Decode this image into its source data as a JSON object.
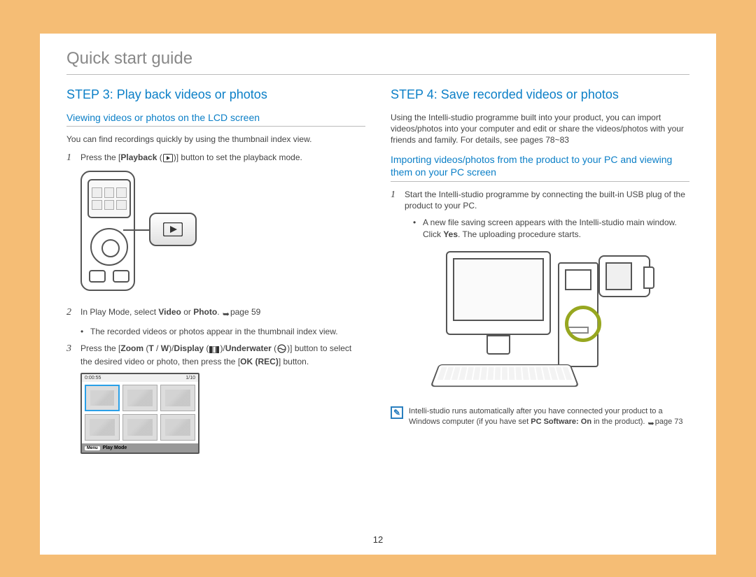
{
  "page_title": "Quick start guide",
  "page_number": "12",
  "left": {
    "step_heading": "STEP 3: Play back videos or photos",
    "sub_heading": "Viewing videos or photos on the LCD screen",
    "intro": "You can find recordings quickly by using the thumbnail index view.",
    "item1_num": "1",
    "item1_a": "Press the [",
    "item1_bold": "Playback",
    "item1_b": " (",
    "item1_c": ")] button to set the playback mode.",
    "item2_num": "2",
    "item2_a": "In Play Mode, select ",
    "item2_bold1": "Video",
    "item2_b": " or ",
    "item2_bold2": "Photo",
    "item2_c": ". ",
    "item2_ref": "page 59",
    "bullet2": "The recorded videos or photos appear in the thumbnail index view.",
    "item3_num": "3",
    "item3_a": "Press the [",
    "item3_bold1": "Zoom",
    "item3_b": " (",
    "item3_bold2": "T",
    "item3_c": " / ",
    "item3_bold3": "W",
    "item3_d": ")/",
    "item3_bold4": "Display",
    "item3_e": " (",
    "item3_f": ")/",
    "item3_bold5": "Underwater",
    "item3_g": " (",
    "item3_h": ")] button to select the desired video or photo, then press the [",
    "item3_bold6": "OK (REC)",
    "item3_i": "] button.",
    "thumb_time": "0:00:55",
    "thumb_count": "1/10",
    "thumb_menu": "Menu",
    "thumb_mode": "Play Mode"
  },
  "right": {
    "step_heading": "STEP 4: Save recorded videos or photos",
    "intro": "Using the Intelli-studio programme built into your product, you can import videos/photos into your computer and edit or share the videos/photos with your friends and family. For details, see pages 78~83",
    "sub_heading": "Importing videos/photos from the product to your PC and viewing them on your PC screen",
    "item1_num": "1",
    "item1": "Start the Intelli-studio programme by connecting the built-in USB plug of the product to your PC.",
    "sub_bullet_a": "A new file saving screen appears with the Intelli-studio main window. Click ",
    "sub_bullet_bold": "Yes",
    "sub_bullet_b": ". The uploading procedure starts.",
    "note_a": "Intelli-studio runs automatically after you have connected your product to a Windows computer (if you have set ",
    "note_bold": "PC Software: On",
    "note_b": " in the product). ",
    "note_ref": "page 73"
  }
}
